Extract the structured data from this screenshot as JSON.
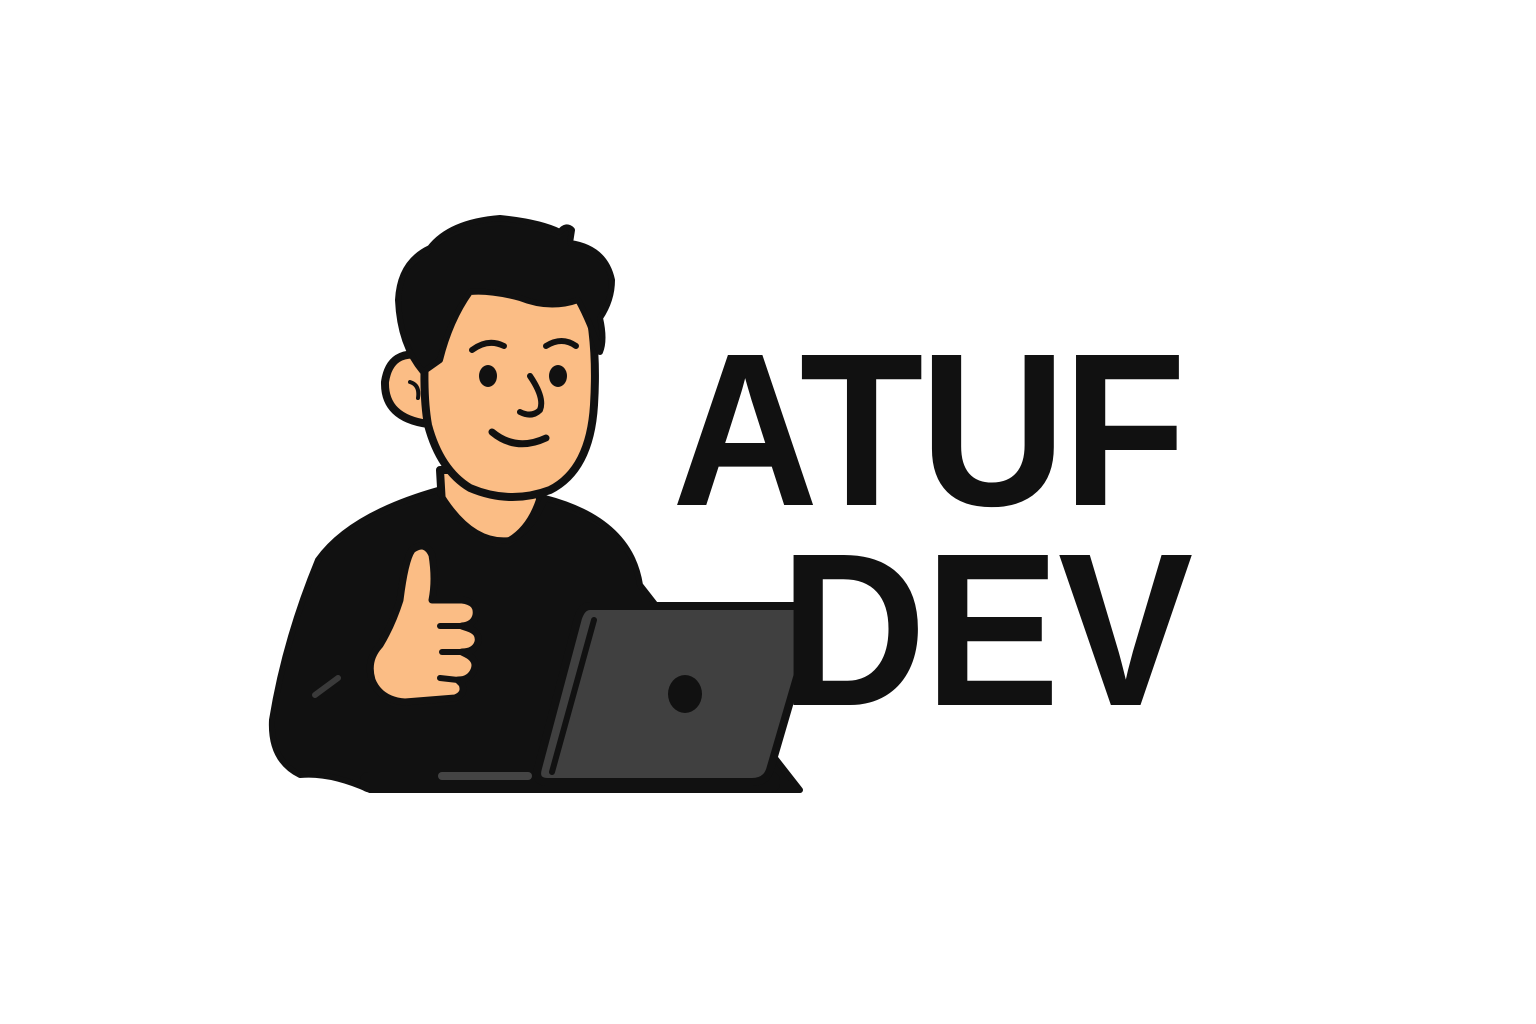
{
  "logo": {
    "wordmark_line_1": "ATUF",
    "wordmark_line_2": "DEV"
  },
  "illustration": {
    "subject": "developer-thumbs-up-with-laptop",
    "icons": [
      "person-illustration",
      "thumbs-up-hand",
      "laptop-icon"
    ]
  },
  "colors": {
    "background": "#ffffff",
    "ink": "#111111",
    "skin": "#fbbd85",
    "laptop": "#404040"
  }
}
